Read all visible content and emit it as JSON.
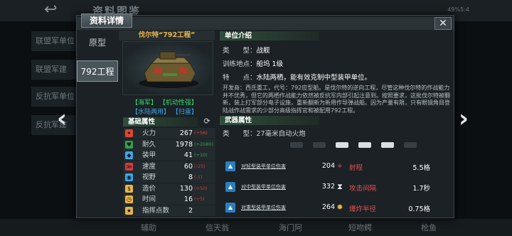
{
  "background": {
    "title": "资料图鉴",
    "status": "49%5:4",
    "side_items": [
      "联盟军单位",
      "联盟军建",
      "反抗军单位",
      "反抗军建"
    ],
    "bottom_tabs": [
      "辅助",
      "信天翁",
      "海门阿",
      "短吻鳄",
      "枪鱼"
    ]
  },
  "dialog": {
    "title": "资料详情",
    "close_label": "✕",
    "variants": [
      "原型",
      "792工程"
    ],
    "unit_name": "伐尔特“792工程”",
    "tags": {
      "row1": [
        "【海军】",
        "【机动性强】"
      ],
      "row2": [
        "【水陆两用】",
        "【扫雷】"
      ]
    },
    "base_attr_header": "基础属性",
    "attributes": [
      {
        "icon": "fire-icon",
        "name": "火力",
        "value": "267",
        "bonus": "(+56)",
        "color": "#e0472e"
      },
      {
        "icon": "durability-icon",
        "name": "耐久",
        "value": "1978",
        "bonus": "(+2080)",
        "color": "#2ea34f"
      },
      {
        "icon": "armor-icon",
        "name": "装甲",
        "value": "41",
        "bonus": "(+10)",
        "color": "#2ea34f"
      },
      {
        "icon": "speed-icon",
        "name": "速度",
        "value": "60",
        "bonus": "(-25)",
        "color": "#d23b3b"
      },
      {
        "icon": "vision-icon",
        "name": "视野",
        "value": "8",
        "bonus": "(-1)",
        "color": "#d23b3b"
      },
      {
        "icon": "cost-icon",
        "name": "造价",
        "value": "130",
        "bonus": "(+50)",
        "color": "#d23b3b"
      },
      {
        "icon": "time-icon",
        "name": "时间",
        "value": "16",
        "bonus": "(+5)",
        "color": "#d23b3b"
      },
      {
        "icon": "command-icon",
        "name": "指挥点数",
        "value": "2",
        "bonus": "",
        "color": "#2ea34f"
      }
    ],
    "intro_header": "单位介绍",
    "type_label": "类　　型：",
    "type_value": "战舰",
    "training_label": "训练地点：",
    "training_value": "船坞 1级",
    "feature_label": "特　　点：",
    "feature_value": "水陆两栖，能有效克制中型装甲单位。",
    "description": "开发商：西氏重工，代号：792应型船。是伐尔特的逆向工程，尽管这种伐尔特的作战能力并不优秀，但它的两栖作战能力依然被反抗军内部引起注意到。按照要求，这批伐尔特被翻新，装上打军部分电子设施，重新翻新为新用作导弹战船。因为产量有限，只有眼镜角目登陆战作战需求的少部分高级指挥官和被配用792工程。",
    "weapon_header": "武器属性",
    "weapon_type_label": "类　　型：",
    "weapon_type_value": "27毫米自动火炮",
    "target_icons": [
      "plane-icon",
      "plane-icon",
      "helicopter-icon",
      "tank-icon",
      "ship-icon",
      "submarine-icon"
    ],
    "weapon_rows": [
      {
        "dmg_label": "对轻型装甲单位伤害",
        "dmg_value": "204",
        "stat_icon": "range-icon",
        "stat_label": "射程",
        "stat_value": "5.5格"
      },
      {
        "dmg_label": "对中型装甲单位伤害",
        "dmg_value": "332",
        "stat_icon": "hourglass-icon",
        "stat_label": "攻击间隔",
        "stat_value": "1.7秒"
      },
      {
        "dmg_label": "对重型装甲单位伤害",
        "dmg_value": "264",
        "stat_icon": "explosion-icon",
        "stat_label": "爆炸半径",
        "stat_value": "0.75格"
      }
    ]
  }
}
